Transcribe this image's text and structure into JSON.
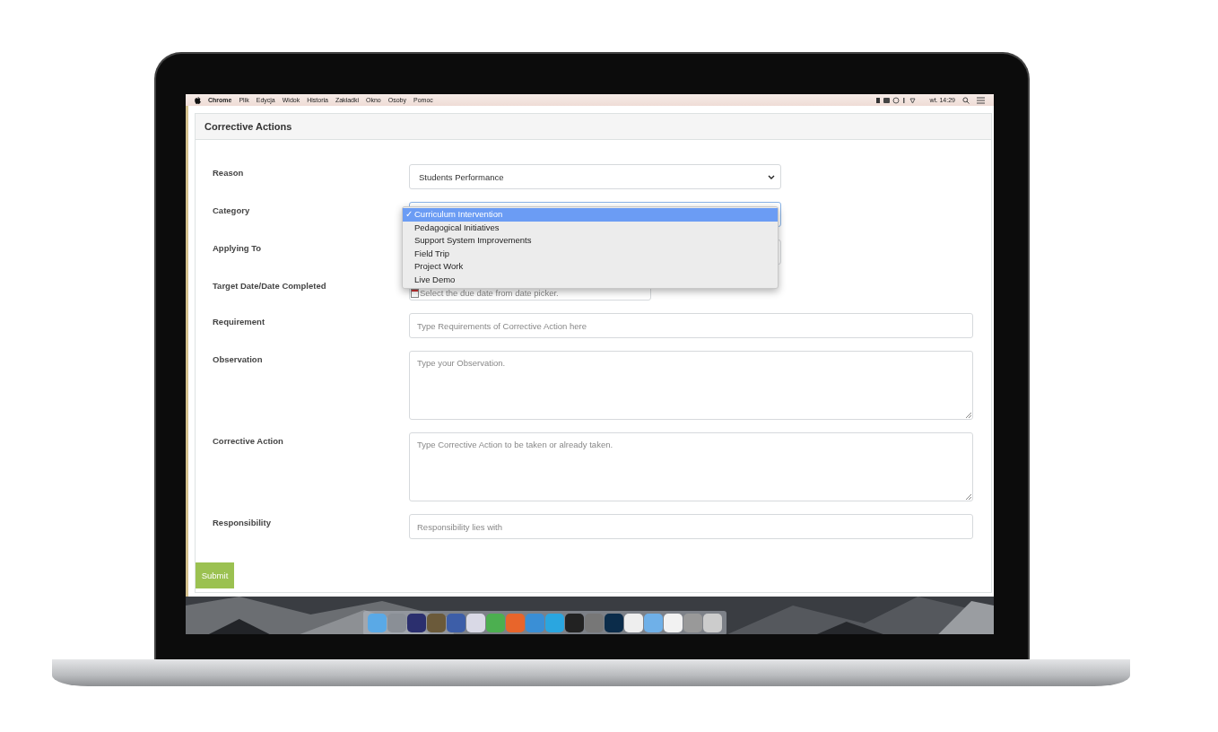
{
  "menu_bar": {
    "app": "Chrome",
    "menus": [
      "Plik",
      "Edycja",
      "Widok",
      "Historia",
      "Zakładki",
      "Okno",
      "Osoby",
      "Pomoc"
    ],
    "clock": "wt. 14:29"
  },
  "panel": {
    "title": "Corrective Actions"
  },
  "fields": [
    {
      "label": "Reason",
      "kind": "select",
      "value": "Students Performance",
      "open": false
    },
    {
      "label": "Category",
      "kind": "select",
      "open": true,
      "check": "✓",
      "options": [
        {
          "label": "Curriculum Intervention",
          "selected": true
        },
        {
          "label": "Pedagogical Initiatives",
          "selected": false
        },
        {
          "label": "Support System Improvements",
          "selected": false
        },
        {
          "label": "Field Trip",
          "selected": false
        },
        {
          "label": "Project Work",
          "selected": false
        },
        {
          "label": "Live Demo",
          "selected": false
        }
      ]
    },
    {
      "label": "Applying To",
      "kind": "select",
      "open": false
    },
    {
      "label": "Target Date/Date Completed",
      "kind": "date",
      "placeholder": "Select the due date from date picker."
    },
    {
      "label": "Requirement",
      "kind": "text",
      "placeholder": "Type Requirements of Corrective Action here"
    },
    {
      "label": "Observation",
      "kind": "textarea",
      "placeholder": "Type your Observation."
    },
    {
      "label": "Corrective Action",
      "kind": "textarea",
      "placeholder": "Type Corrective Action to be taken or already taken."
    },
    {
      "label": "Responsibility",
      "kind": "text",
      "placeholder": "Responsibility lies with"
    }
  ],
  "submit": "Submit"
}
